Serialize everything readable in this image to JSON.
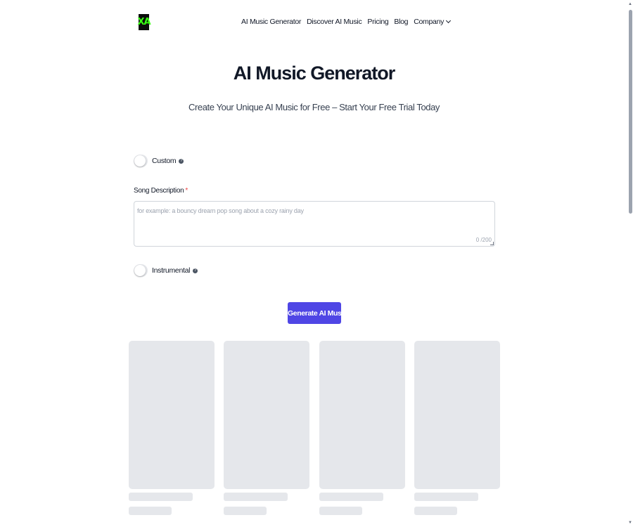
{
  "header": {
    "logo_text": "XA",
    "nav": [
      {
        "label": "AI Music Generator"
      },
      {
        "label": "Discover AI Music"
      },
      {
        "label": "Pricing"
      },
      {
        "label": "Blog"
      },
      {
        "label": "Company"
      }
    ]
  },
  "hero": {
    "title": "AI Music Generator",
    "subtitle": "Create Your Unique AI Music for Free – Start Your Free Trial Today"
  },
  "form": {
    "custom_toggle": {
      "label": "Custom",
      "on": false
    },
    "song_description": {
      "label": "Song Description",
      "required_mark": "*",
      "value": "",
      "placeholder": "for example: a bouncy dream pop song about a cozy rainy day",
      "counter": "0 /200"
    },
    "instrumental_toggle": {
      "label": "Instrumental",
      "on": false
    },
    "help_glyph": "?",
    "generate_label": "Generate AI Music"
  },
  "colors": {
    "accent": "#4f46e5",
    "logo_bg": "#0b0b0b",
    "logo_fg": "#39ff14",
    "skeleton": "#e5e7eb",
    "required": "#ef4444"
  },
  "icons": [
    "chevron-down-icon",
    "help-icon",
    "resize-grip-icon"
  ]
}
